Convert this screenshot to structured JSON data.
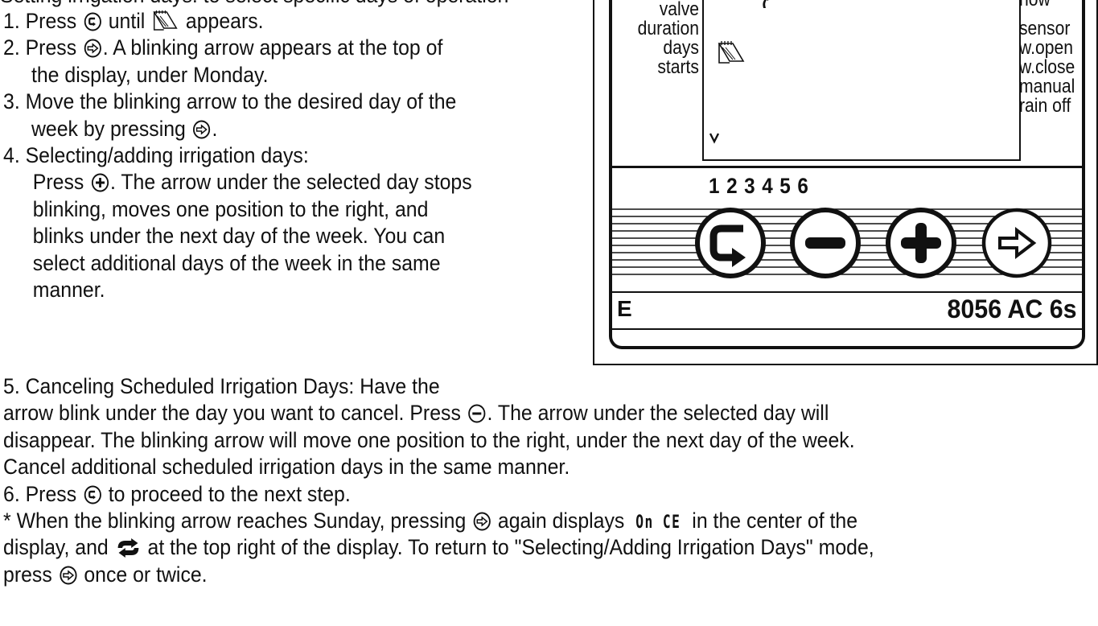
{
  "intro_cut": "Setting irrigation days: to select specific days of operation",
  "steps": {
    "s1_pre": "1. Press",
    "s1_mid": "until",
    "s1_post": "appears.",
    "s2_pre": "2. Press",
    "s2_post": ". A blinking arrow appears at the top of",
    "s2_l2": "the display, under Monday.",
    "s3_l1": "3. Move the blinking arrow to the desired day of the",
    "s3_l2_pre": "week by pressing",
    "s3_l2_post": ".",
    "s4_l1": "4. Selecting/adding irrigation days:",
    "s4_l2_pre": "Press",
    "s4_l2_post": ". The arrow under the selected day stops",
    "s4_l3": "blinking, moves one position to the right, and",
    "s4_l4": "blinks under the next day of the week. You can",
    "s4_l5": "select additional days of the week in the same",
    "s4_l6": "manner.",
    "s5_l1": "5. Canceling Scheduled Irrigation Days: Have the",
    "s5_l2_pre": "arrow blink under the day you want to cancel. Press",
    "s5_l2_post": ". The arrow under the selected day will",
    "s5_l3": "disappear. The blinking arrow will move one position to the right, under the next day of the week.",
    "s5_l4": "Cancel additional scheduled irrigation days in the same manner.",
    "s6_pre": "6. Press",
    "s6_post": "to proceed to the next step.",
    "note_l1_pre": "* When the blinking arrow reaches Sunday, pressing",
    "note_l1_lcd": "On CE",
    "note_l1_post": "in the center of the",
    "note_l1_mid": "again displays",
    "note_l2_pre": "display, and",
    "note_l2_post": "at the top right of the display. To return to \"Selecting/Adding Irrigation Days\" mode,",
    "note_l3_pre": "press",
    "note_l3_post": "once or twice."
  },
  "controller": {
    "left_labels": [
      "valve",
      "duration",
      "days",
      "starts"
    ],
    "right_labels": [
      "now",
      "sensor",
      "w.open",
      "w.close",
      "manual",
      "rain off"
    ],
    "zones": "1 2 3 4 5 6",
    "model_letter": "E",
    "model": "8056 AC 6s",
    "buttons": [
      "cycle",
      "minus",
      "plus",
      "next"
    ]
  }
}
